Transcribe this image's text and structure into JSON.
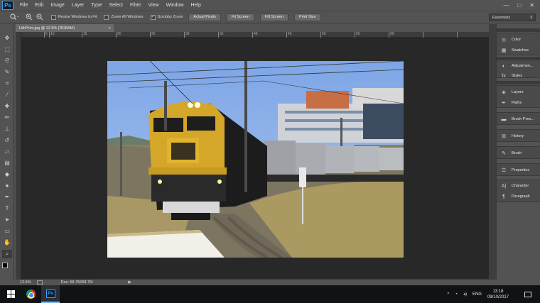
{
  "app": {
    "logo": "Ps",
    "menu": [
      "File",
      "Edit",
      "Image",
      "Layer",
      "Type",
      "Select",
      "Filter",
      "View",
      "Window",
      "Help"
    ],
    "window_controls": [
      "—",
      "□",
      "✕"
    ]
  },
  "options_bar": {
    "resize_windows_label": "Resize Windows to Fit",
    "resize_windows_checked": false,
    "zoom_all_label": "Zoom All Windows",
    "zoom_all_checked": false,
    "scrubby_zoom_label": "Scrubby Zoom",
    "scrubby_zoom_checked": true,
    "buttons": [
      "Actual Pixels",
      "Fit Screen",
      "Fill Screen",
      "Print Size"
    ],
    "workspace": "Essentials"
  },
  "document": {
    "tab_title": "LithPrint.jpg @ 12.5% (RGB/8#)",
    "ruler_labels": [
      "0",
      "5",
      "10",
      "15",
      "20",
      "25",
      "30",
      "35",
      "40",
      "45",
      "50",
      "55",
      "60"
    ]
  },
  "status_bar": {
    "zoom": "12.5%",
    "doc_info": "Doc: 68.7M/68.7M"
  },
  "panels": {
    "group1": [
      {
        "icon": "color-icon",
        "label": "Color"
      },
      {
        "icon": "swatches-icon",
        "label": "Swatches"
      }
    ],
    "group2": [
      {
        "icon": "adjustments-icon",
        "label": "Adjustmen..."
      },
      {
        "icon": "styles-icon",
        "label": "Styles"
      }
    ],
    "group3": [
      {
        "icon": "layers-icon",
        "label": "Layers"
      },
      {
        "icon": "paths-icon",
        "label": "Paths"
      }
    ],
    "group4": [
      {
        "icon": "brush-presets-icon",
        "label": "Brush Pres..."
      }
    ],
    "group5": [
      {
        "icon": "history-icon",
        "label": "History"
      }
    ],
    "group6": [
      {
        "icon": "brush-icon",
        "label": "Brush"
      }
    ],
    "group7": [
      {
        "icon": "properties-icon",
        "label": "Properties"
      }
    ],
    "group8": [
      {
        "icon": "character-icon",
        "label": "Character"
      },
      {
        "icon": "paragraph-icon",
        "label": "Paragraph"
      }
    ]
  },
  "taskbar": {
    "language": "ENG",
    "time": "13:18",
    "date": "09/10/2017"
  }
}
